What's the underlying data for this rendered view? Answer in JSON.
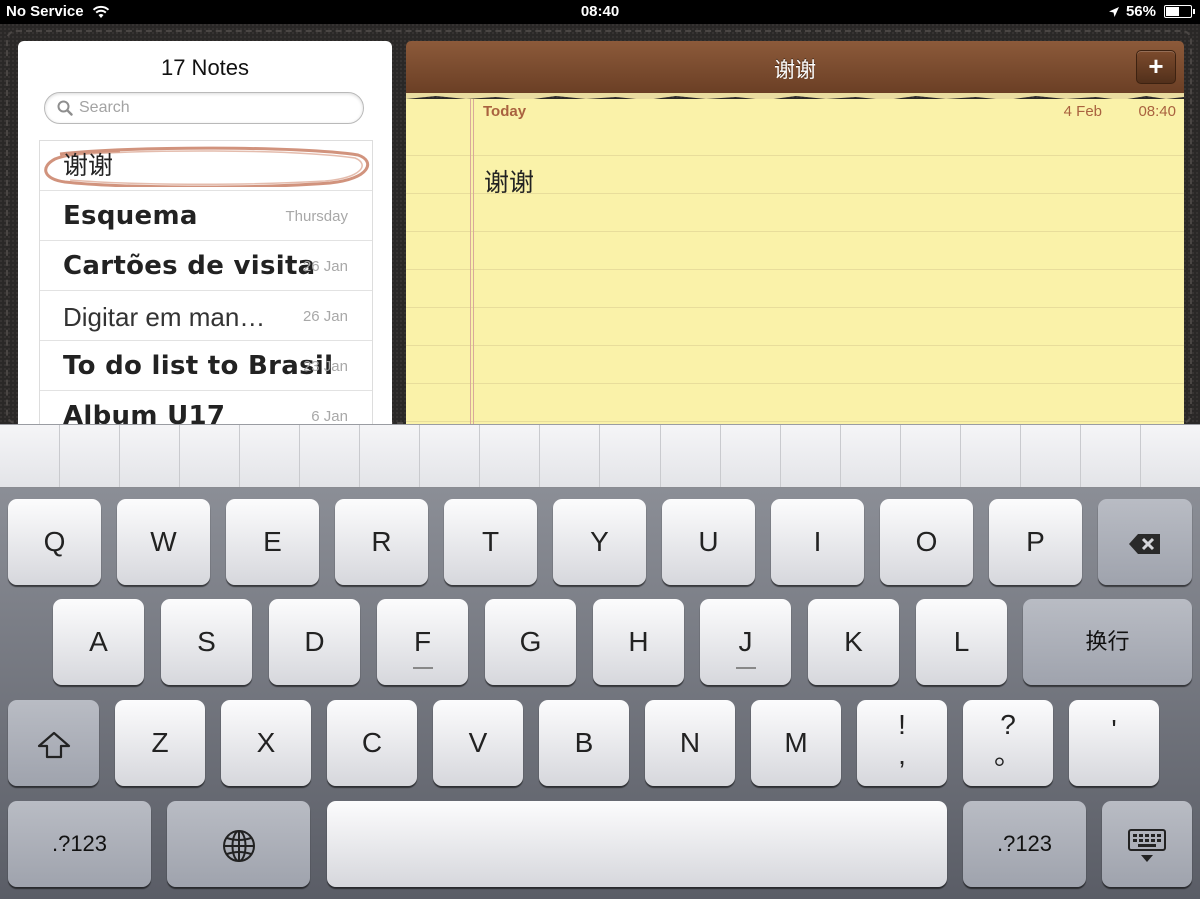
{
  "status": {
    "carrier": "No Service",
    "time": "08:40",
    "battery": "56%",
    "battery_fraction": 0.56
  },
  "list": {
    "title": "17 Notes",
    "search_placeholder": "Search",
    "notes": [
      {
        "title": "谢谢",
        "date": ""
      },
      {
        "title": "Esquema",
        "date": "Thursday"
      },
      {
        "title": "Cartões de visita",
        "date": "26 Jan"
      },
      {
        "title": "Digitar em man…",
        "date": "26 Jan"
      },
      {
        "title": "To do list to Brasil",
        "date": "23 Jan"
      },
      {
        "title": "Album U17",
        "date": "6 Jan"
      }
    ]
  },
  "note": {
    "header_title": "谢谢",
    "add_label": "+",
    "day": "Today",
    "date": "4 Feb",
    "time": "08:40",
    "body": "谢谢"
  },
  "keyboard": {
    "row1": [
      "Q",
      "W",
      "E",
      "R",
      "T",
      "Y",
      "U",
      "I",
      "O",
      "P"
    ],
    "row2": [
      "A",
      "S",
      "D",
      "F",
      "G",
      "H",
      "J",
      "K",
      "L"
    ],
    "return_label": "换行",
    "row3": [
      "Z",
      "X",
      "C",
      "V",
      "B",
      "N",
      "M"
    ],
    "punct1_top": "!",
    "punct1_bottom": ",",
    "punct2_top": "?",
    "punct2_bottom": "。",
    "comma": "'",
    "numbers_label": ".?123",
    "numbers_label_right": ".?123",
    "icons": {
      "backspace": "backspace-icon",
      "shift": "shift-icon",
      "globe": "globe-icon",
      "hide": "keyboard-hide-icon"
    }
  },
  "colors": {
    "header_brown": "#7b4a2e",
    "paper_yellow": "#faf2a9",
    "accent_text": "#a9623f"
  }
}
